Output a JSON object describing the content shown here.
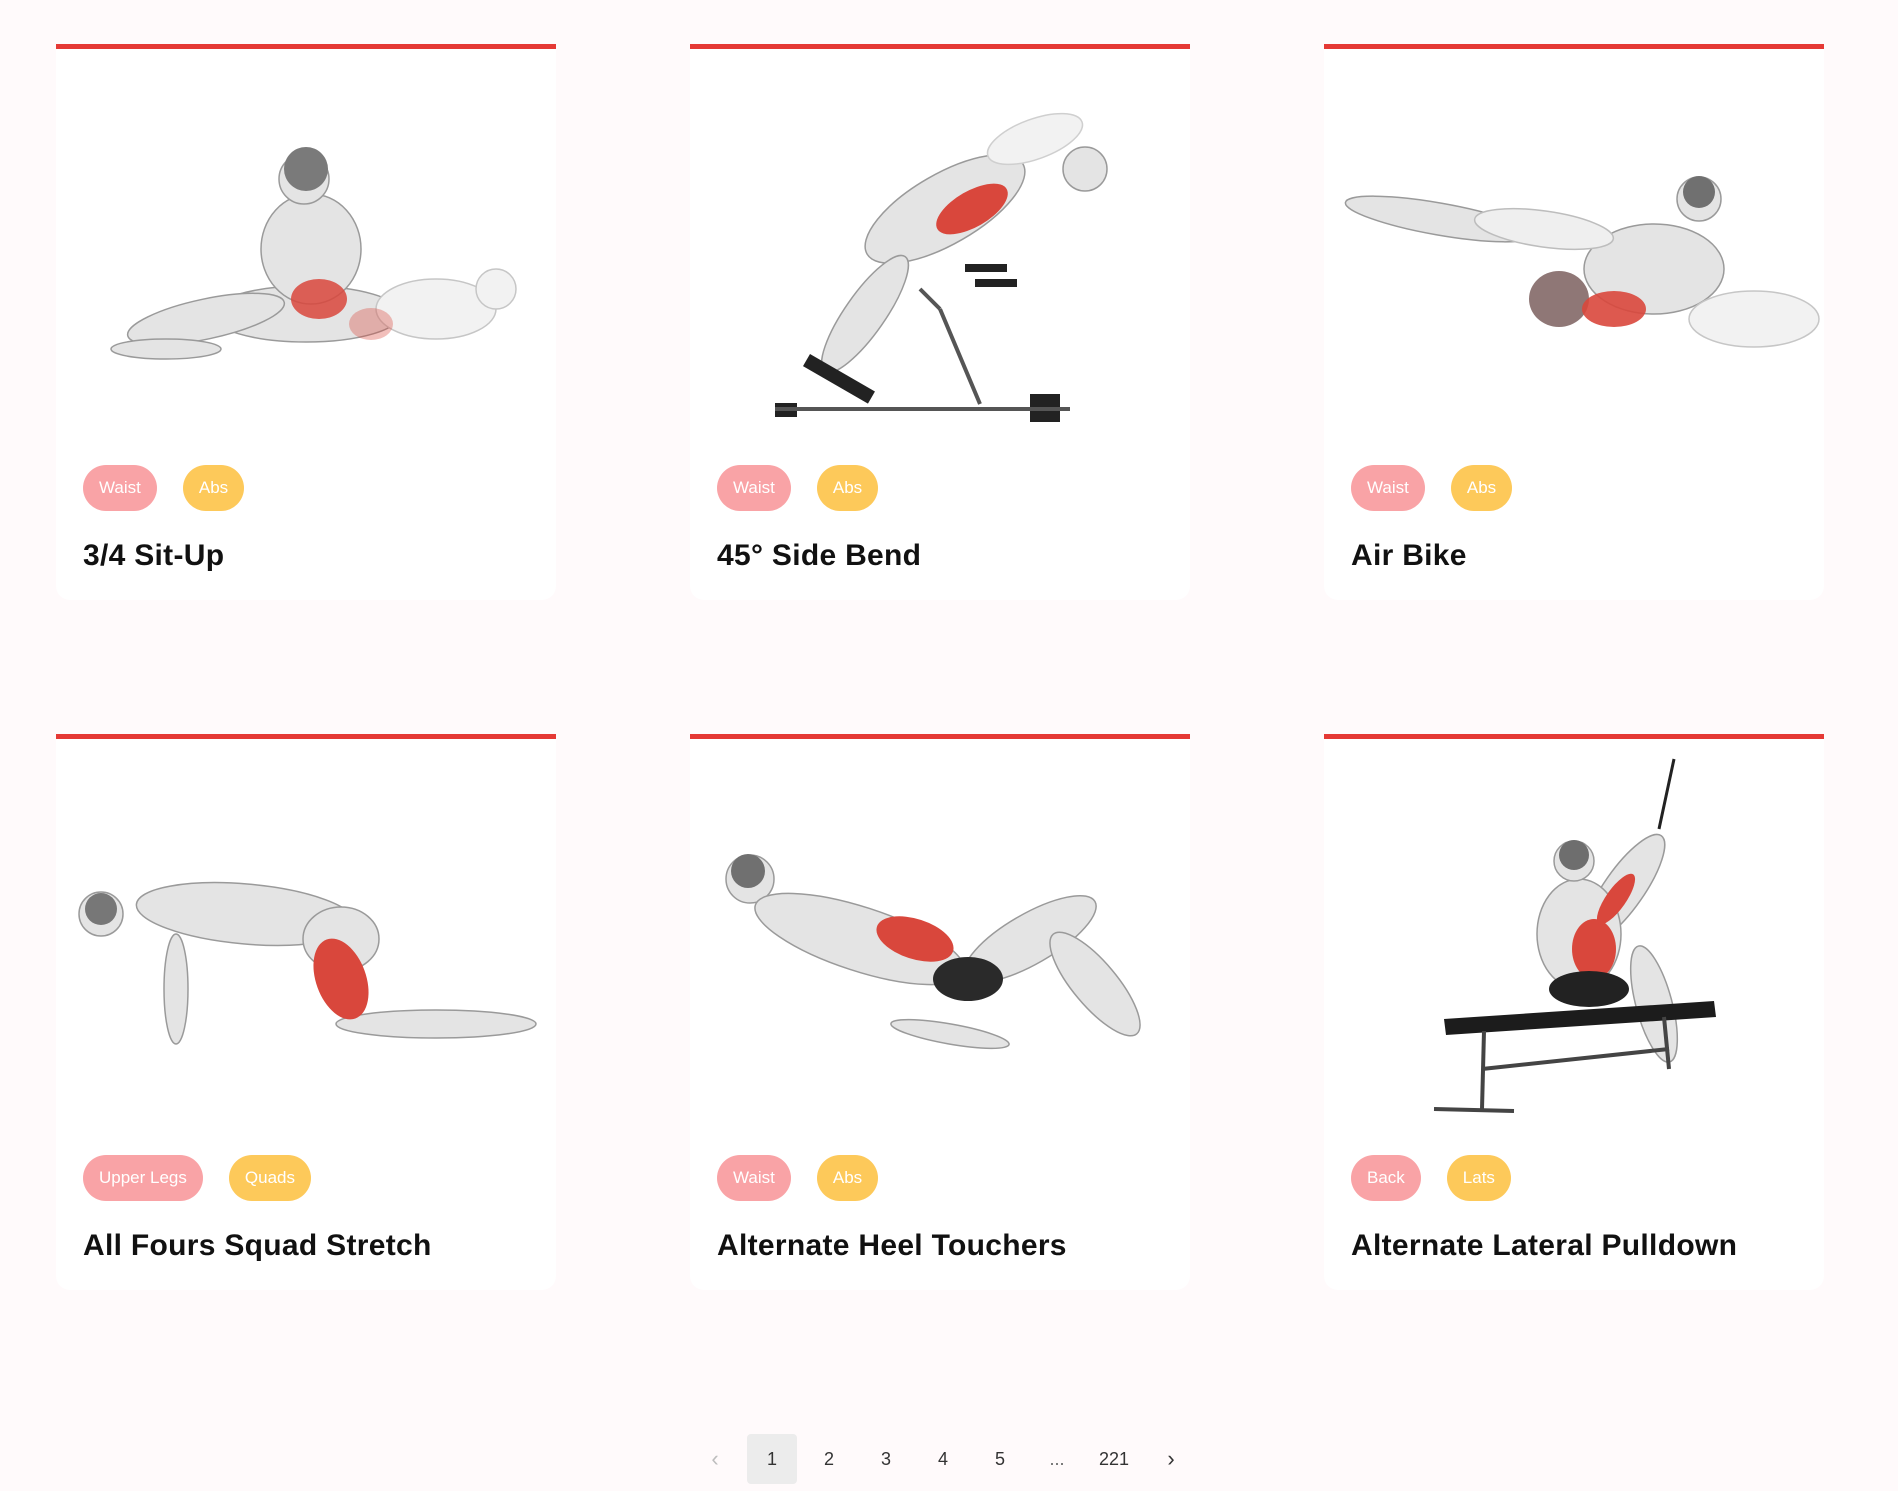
{
  "exercises": [
    {
      "title": "3/4 Sit-Up",
      "tags": [
        {
          "label": "Waist",
          "kind": "body-part"
        },
        {
          "label": "Abs",
          "kind": "target"
        }
      ],
      "image_icon": "situp-illustration"
    },
    {
      "title": "45° Side Bend",
      "tags": [
        {
          "label": "Waist",
          "kind": "body-part"
        },
        {
          "label": "Abs",
          "kind": "target"
        }
      ],
      "image_icon": "side-bend-illustration"
    },
    {
      "title": "Air Bike",
      "tags": [
        {
          "label": "Waist",
          "kind": "body-part"
        },
        {
          "label": "Abs",
          "kind": "target"
        }
      ],
      "image_icon": "air-bike-illustration"
    },
    {
      "title": "All Fours Squad Stretch",
      "tags": [
        {
          "label": "Upper Legs",
          "kind": "body-part"
        },
        {
          "label": "Quads",
          "kind": "target"
        }
      ],
      "image_icon": "quad-stretch-illustration"
    },
    {
      "title": "Alternate Heel Touchers",
      "tags": [
        {
          "label": "Waist",
          "kind": "body-part"
        },
        {
          "label": "Abs",
          "kind": "target"
        }
      ],
      "image_icon": "heel-touchers-illustration"
    },
    {
      "title": "Alternate Lateral Pulldown",
      "tags": [
        {
          "label": "Back",
          "kind": "body-part"
        },
        {
          "label": "Lats",
          "kind": "target"
        }
      ],
      "image_icon": "lateral-pulldown-illustration"
    }
  ],
  "pagination": {
    "prev_icon": "chevron-left-icon",
    "next_icon": "chevron-right-icon",
    "pages": [
      "1",
      "2",
      "3",
      "4",
      "5"
    ],
    "ellipsis": "...",
    "last_page": "221",
    "current_page": "1"
  },
  "colors": {
    "page_background": "#fffafb",
    "card_accent": "#e53935",
    "body_part_tag": "#f9a3a6",
    "target_tag": "#fdc95a",
    "muscle_highlight": "#d9473c"
  }
}
